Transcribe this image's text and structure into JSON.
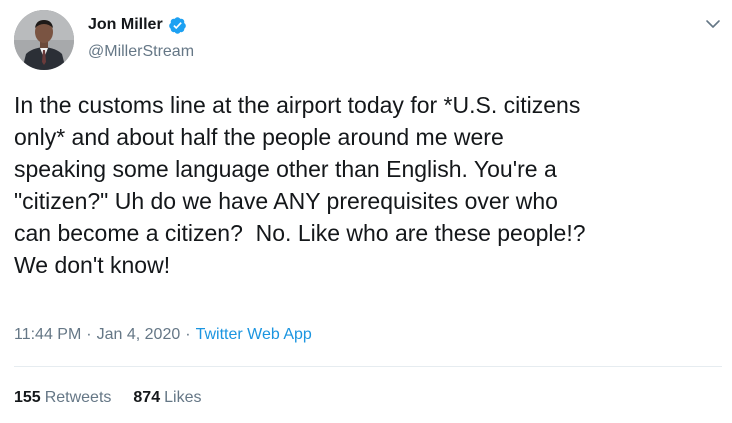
{
  "author": {
    "display_name": "Jon Miller",
    "handle": "@MillerStream",
    "verified": true,
    "avatar_icon": "profile-photo"
  },
  "tweet": {
    "text": "In the customs line at the airport today for *U.S. citizens\nonly* and about half the people around me were\nspeaking some language other than English. You're a\n\"citizen?\" Uh do we have ANY prerequisites over who\ncan become a citizen?  No. Like who are these people!?\nWe don't know!",
    "time": "11:44 PM",
    "date": "Jan 4, 2020",
    "separator": "·",
    "source": "Twitter Web App"
  },
  "stats": {
    "retweets_count": "155",
    "retweets_label": "Retweets",
    "likes_count": "874",
    "likes_label": "Likes"
  },
  "colors": {
    "accent": "#1da1f2",
    "secondary_text": "#657786",
    "link": "#1b95e0",
    "divider": "#e6ecf0"
  }
}
